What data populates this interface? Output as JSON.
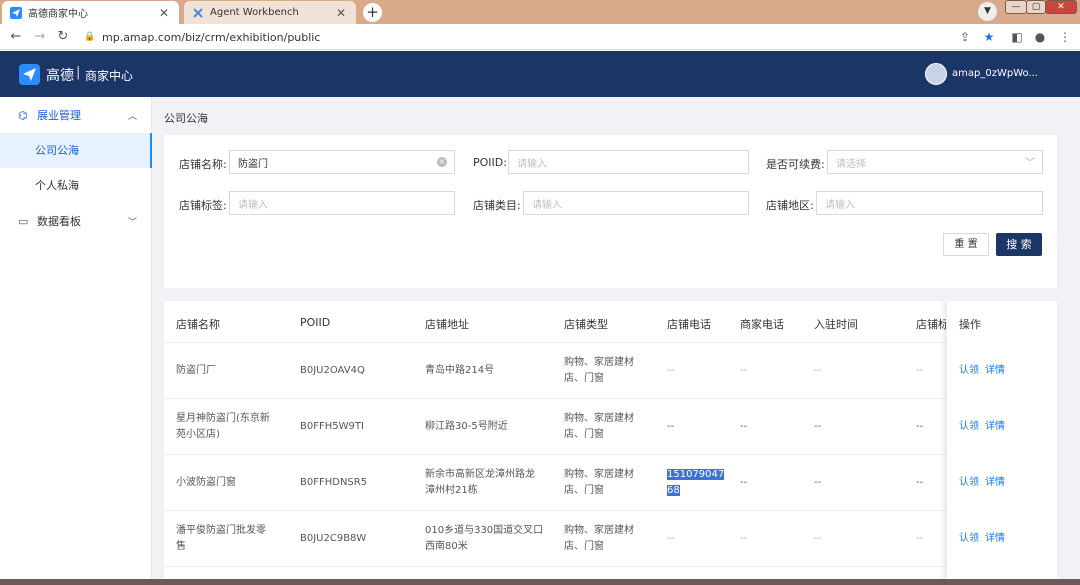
{
  "browser": {
    "tabs": [
      {
        "title": "高德商家中心",
        "active": true
      },
      {
        "title": "Agent Workbench",
        "active": false
      }
    ],
    "url": "mp.amap.com/biz/crm/exhibition/public"
  },
  "header": {
    "brand": "高德",
    "separator": "|",
    "subtitle": "商家中心",
    "username": "amap_0zWpWo..."
  },
  "sidebar": {
    "groups": [
      {
        "label": "展业管理",
        "icon": "cube-icon",
        "expanded": true
      },
      {
        "label": "数据看板",
        "icon": "monitor-icon",
        "expanded": false
      }
    ],
    "items": [
      {
        "label": "公司公海",
        "active": true
      },
      {
        "label": "个人私海",
        "active": false
      }
    ]
  },
  "breadcrumb": "公司公海",
  "filters": {
    "shop_name": {
      "label": "店铺名称:",
      "value": "防盗门"
    },
    "poiid": {
      "label": "POIID:",
      "placeholder": "请输入"
    },
    "renewable": {
      "label": "是否可续费:",
      "placeholder": "请选择"
    },
    "shop_tag": {
      "label": "店铺标签:",
      "placeholder": "请输入"
    },
    "shop_category": {
      "label": "店铺类目:",
      "placeholder": "请输入"
    },
    "shop_region": {
      "label": "店铺地区:",
      "placeholder": "请输入"
    },
    "reset_label": "重 置",
    "search_label": "搜 索"
  },
  "table": {
    "columns": [
      "店铺名称",
      "POIID",
      "店铺地址",
      "店铺类型",
      "店铺电话",
      "商家电话",
      "入驻时间",
      "店铺标",
      "操作"
    ],
    "rows": [
      {
        "name": [
          "防盗门厂"
        ],
        "poiid": "B0JU2OAV4Q",
        "address": [
          "青岛中路214号"
        ],
        "type": [
          "购物、家居建材",
          "店、门窗"
        ],
        "shop_phone": "--",
        "merchant_phone": "--",
        "join_time": "--",
        "tag": "--",
        "claim": "认领",
        "detail": "详情"
      },
      {
        "name": [
          "星月神防盗门(东京新",
          "苑小区店)"
        ],
        "poiid": "B0FFH5W9TI",
        "address": [
          "柳江路30-5号附近"
        ],
        "type": [
          "购物、家居建材",
          "店、门窗"
        ],
        "shop_phone": "--",
        "merchant_phone": "--",
        "join_time": "--",
        "tag": "--",
        "claim": "认领",
        "detail": "详情"
      },
      {
        "name": [
          "小波防盗门窗"
        ],
        "poiid": "B0FFHDNSR5",
        "address": [
          "新余市高新区龙漳州路龙",
          "漳州村21栋"
        ],
        "type": [
          "购物、家居建材",
          "店、门窗"
        ],
        "shop_phone": [
          "151079047",
          "68"
        ],
        "merchant_phone": "--",
        "join_time": "--",
        "tag": "--",
        "claim": "认领",
        "detail": "详情"
      },
      {
        "name": [
          "潘平俊防盗门批发零",
          "售"
        ],
        "poiid": "B0JU2C9B8W",
        "address": [
          "010乡道与330国道交叉口",
          "西南80米"
        ],
        "type": [
          "购物、家居建材",
          "店、门窗"
        ],
        "shop_phone": "--",
        "merchant_phone": "--",
        "join_time": "--",
        "tag": "--",
        "claim": "认领",
        "detail": "详情"
      }
    ]
  }
}
